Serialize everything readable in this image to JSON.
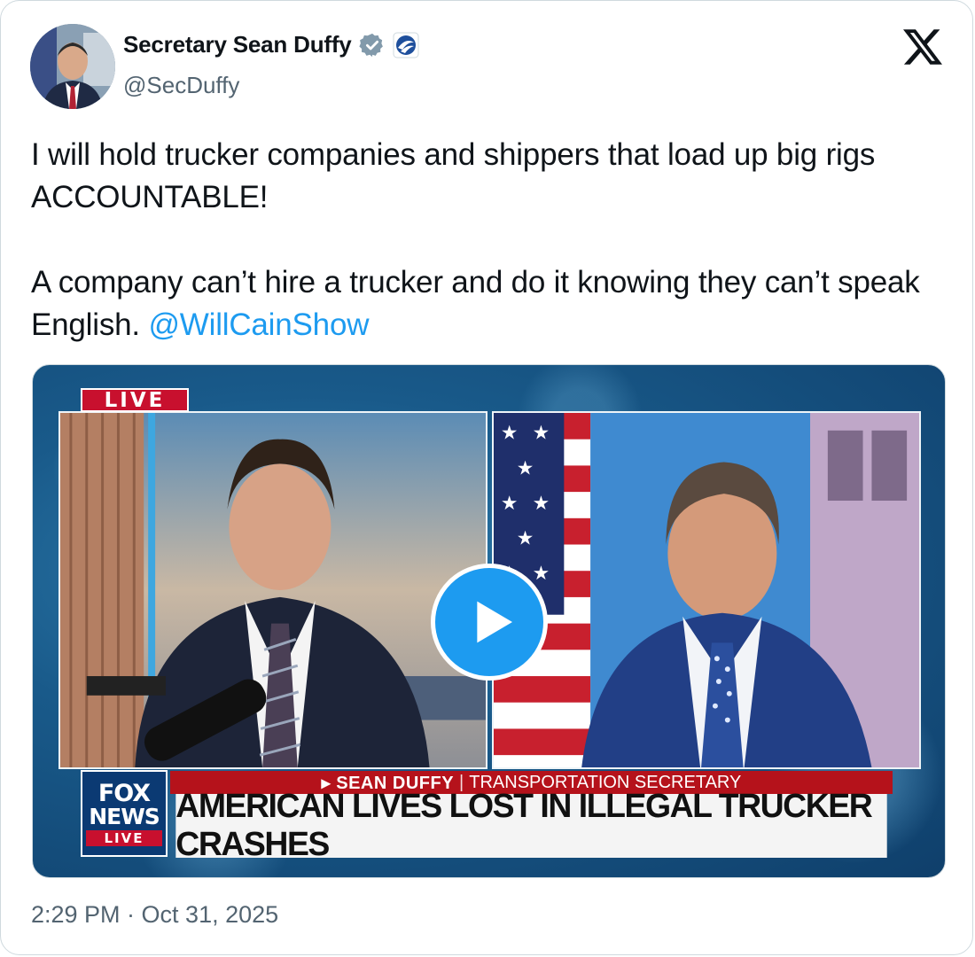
{
  "author": {
    "display_name": "Secretary Sean Duffy",
    "handle": "@SecDuffy",
    "avatar_icon": "profile-photo",
    "verified_icon": "verified-badge-icon",
    "affiliation_icon": "dot-logo-icon"
  },
  "platform": {
    "logo_icon": "x-logo-icon"
  },
  "tweet": {
    "paragraph1": "I will hold trucker companies and shippers that load up big rigs ACCOUNTABLE!",
    "paragraph2_text": "A company can’t hire a trucker and do it knowing they can’t speak English. ",
    "mention": "@WillCainShow"
  },
  "media": {
    "live_label": "LIVE",
    "network_logo": {
      "line1": "FOX",
      "line2": "NEWS",
      "line3": "LIVE"
    },
    "chyron_name": "▸ SEAN DUFFY",
    "chyron_separator": "|",
    "chyron_title": "TRANSPORTATION SECRETARY",
    "headline": "AMERICAN LIVES LOST IN ILLEGAL TRUCKER CRASHES",
    "play_icon": "play-icon"
  },
  "timestamp": "2:29 PM · Oct 31, 2025",
  "colors": {
    "link": "#1d9bf0",
    "secondary_text": "#536471",
    "fox_red": "#b5121b",
    "fox_blue": "#0b3a73"
  }
}
